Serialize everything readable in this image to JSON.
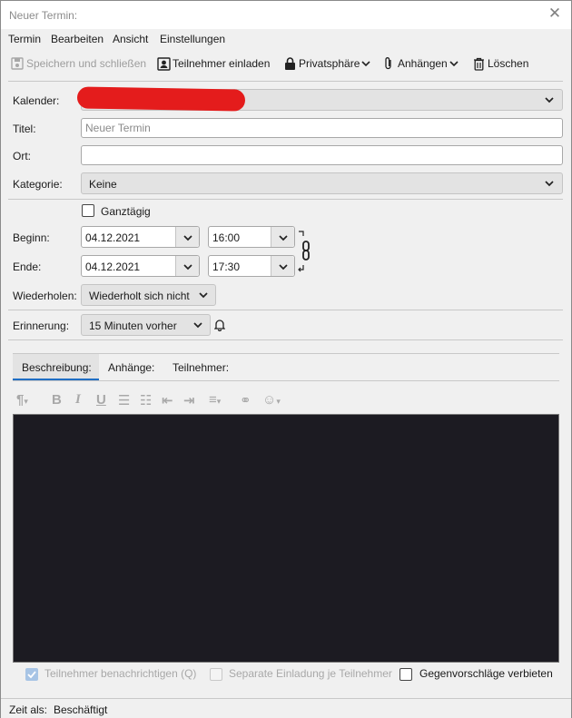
{
  "window": {
    "title": "Neuer Termin:"
  },
  "menu": [
    "Termin",
    "Bearbeiten",
    "Ansicht",
    "Einstellungen"
  ],
  "toolbar": {
    "save_close": "Speichern und schließen",
    "invite": "Teilnehmer einladen",
    "privacy": "Privatsphäre",
    "attach": "Anhängen",
    "delete": "Löschen"
  },
  "form": {
    "calendar_label": "Kalender:",
    "title_label": "Titel:",
    "title_placeholder": "Neuer Termin",
    "location_label": "Ort:",
    "category_label": "Kategorie:",
    "category_value": "Keine",
    "allday_label": "Ganztägig",
    "start_label": "Beginn:",
    "start_date": "04.12.2021",
    "start_time": "16:00",
    "end_label": "Ende:",
    "end_date": "04.12.2021",
    "end_time": "17:30",
    "repeat_label": "Wiederholen:",
    "repeat_value": "Wiederholt sich nicht",
    "reminder_label": "Erinnerung:",
    "reminder_value": "15 Minuten vorher"
  },
  "tabs": [
    "Beschreibung:",
    "Anhänge:",
    "Teilnehmer:"
  ],
  "bottom": {
    "notify": "Teilnehmer benachrichtigen (Q)",
    "separate": "Separate Einladung je Teilnehmer",
    "no_counter": "Gegenvorschläge verbieten"
  },
  "status": {
    "label": "Zeit als:",
    "value": "Beschäftigt"
  },
  "colors": {
    "editor_bg": "#1c1b22",
    "accent": "#1f6ec4",
    "redaction": "#e41c1c"
  }
}
